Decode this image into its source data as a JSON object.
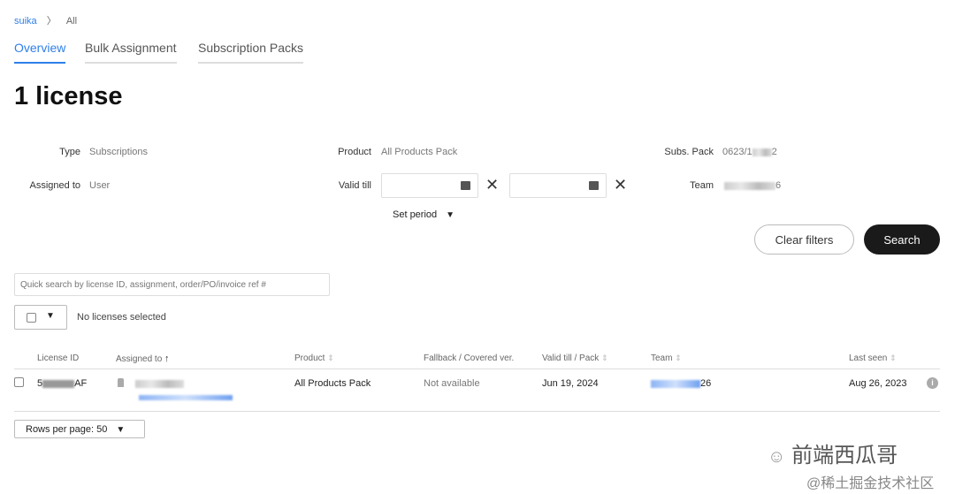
{
  "breadcrumb": {
    "root": "suika",
    "sep": "〉",
    "current": "All"
  },
  "tabs": [
    {
      "label": "Overview",
      "active": true
    },
    {
      "label": "Bulk Assignment"
    },
    {
      "label": "Subscription Packs"
    }
  ],
  "title": "1 license",
  "filters": {
    "type_label": "Type",
    "type_value": "Subscriptions",
    "assigned_label": "Assigned to",
    "assigned_value": "User",
    "product_label": "Product",
    "product_value": "All Products Pack",
    "valid_label": "Valid till",
    "set_period": "Set period",
    "pack_label": "Subs. Pack",
    "pack_prefix": "0623/1",
    "pack_suffix": "2",
    "team_label": "Team",
    "team_suffix": "6",
    "clear": "Clear filters",
    "search": "Search"
  },
  "quick_search_placeholder": "Quick search by license ID, assignment, order/PO/invoice ref #",
  "selection_status": "No licenses selected",
  "table": {
    "headers": [
      "License ID",
      "Assigned to",
      "Product",
      "Fallback / Covered ver.",
      "Valid till / Pack",
      "Team",
      "Last seen"
    ],
    "rows": [
      {
        "id_prefix": "5",
        "id_suffix": "AF",
        "product": "All Products Pack",
        "fallback": "Not available",
        "valid": "Jun 19, 2024",
        "team_suffix": "26",
        "last_seen": "Aug 26, 2023"
      }
    ]
  },
  "rows_per_page": "Rows per page: 50",
  "watermark": {
    "line1": "前端西瓜哥",
    "line2": "@稀土掘金技术社区"
  },
  "colors": {
    "accent": "#2f7fe8",
    "primary_button": "#1a1a1a"
  }
}
